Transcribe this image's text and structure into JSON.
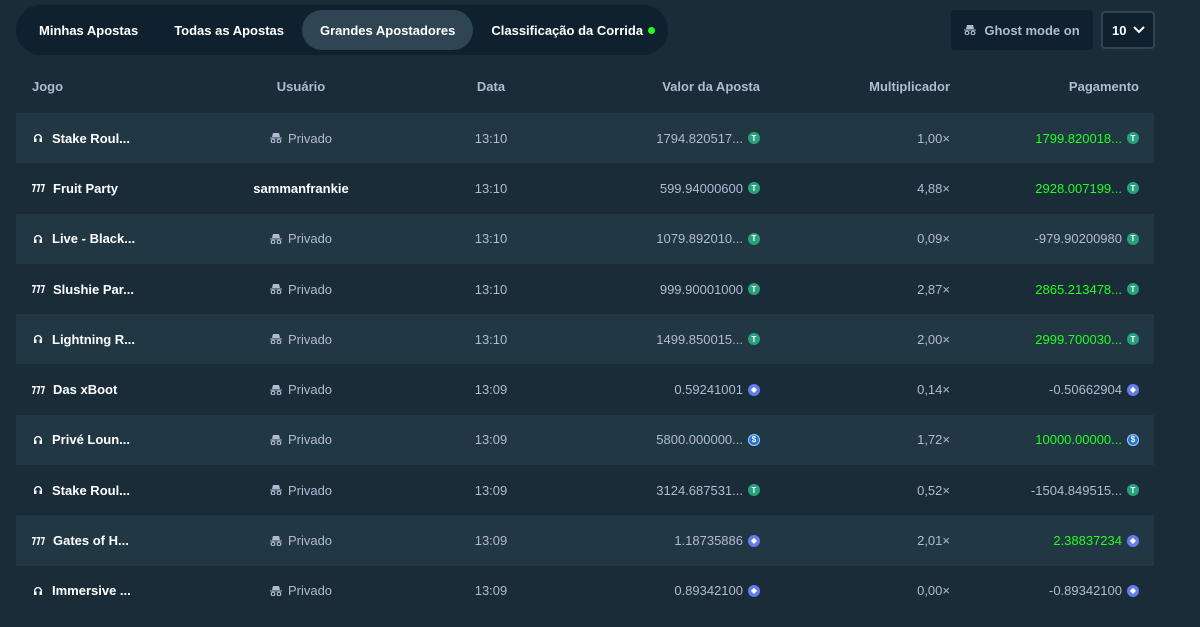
{
  "tabs": [
    {
      "label": "Minhas Apostas",
      "active": false
    },
    {
      "label": "Todas as Apostas",
      "active": false
    },
    {
      "label": "Grandes Apostadores",
      "active": true
    },
    {
      "label": "Classificação da Corrida",
      "active": false,
      "live": true
    }
  ],
  "ghost_mode": {
    "label": "Ghost mode on",
    "icon": "incognito-icon"
  },
  "rows_select": {
    "value": "10",
    "icon": "chevron-down-icon"
  },
  "colors": {
    "win": "#1fff20",
    "panel": "#0f212e",
    "bg": "#1a2c38",
    "row_alt": "#213743"
  },
  "table": {
    "headers": {
      "game": "Jogo",
      "user": "Usuário",
      "date": "Data",
      "bet": "Valor da Aposta",
      "mult": "Multiplicador",
      "payout": "Pagamento"
    },
    "rows": [
      {
        "game": "Stake Roul...",
        "game_icon": "live-casino-icon",
        "user": "Privado",
        "private": true,
        "date": "13:10",
        "bet": "1794.820517...",
        "mult": "1,00×",
        "payout": "1799.820018...",
        "win": true,
        "coin": "usdt"
      },
      {
        "game": "Fruit Party",
        "game_icon": "slots-icon",
        "user": "sammanfrankie",
        "private": false,
        "date": "13:10",
        "bet": "599.94000600",
        "mult": "4,88×",
        "payout": "2928.007199...",
        "win": true,
        "coin": "usdt"
      },
      {
        "game": "Live - Black...",
        "game_icon": "live-casino-icon",
        "user": "Privado",
        "private": true,
        "date": "13:10",
        "bet": "1079.892010...",
        "mult": "0,09×",
        "payout": "-979.90200980",
        "win": false,
        "coin": "usdt"
      },
      {
        "game": "Slushie Par...",
        "game_icon": "slots-icon",
        "user": "Privado",
        "private": true,
        "date": "13:10",
        "bet": "999.90001000",
        "mult": "2,87×",
        "payout": "2865.213478...",
        "win": true,
        "coin": "usdt"
      },
      {
        "game": "Lightning R...",
        "game_icon": "live-casino-icon",
        "user": "Privado",
        "private": true,
        "date": "13:10",
        "bet": "1499.850015...",
        "mult": "2,00×",
        "payout": "2999.700030...",
        "win": true,
        "coin": "usdt"
      },
      {
        "game": "Das xBoot",
        "game_icon": "slots-icon",
        "user": "Privado",
        "private": true,
        "date": "13:09",
        "bet": "0.59241001",
        "mult": "0,14×",
        "payout": "-0.50662904",
        "win": false,
        "coin": "eth"
      },
      {
        "game": "Privé Loun...",
        "game_icon": "live-casino-icon",
        "user": "Privado",
        "private": true,
        "date": "13:09",
        "bet": "5800.000000...",
        "mult": "1,72×",
        "payout": "10000.00000...",
        "win": true,
        "coin": "usdc"
      },
      {
        "game": "Stake Roul...",
        "game_icon": "live-casino-icon",
        "user": "Privado",
        "private": true,
        "date": "13:09",
        "bet": "3124.687531...",
        "mult": "0,52×",
        "payout": "-1504.849515...",
        "win": false,
        "coin": "usdt"
      },
      {
        "game": "Gates of H...",
        "game_icon": "slots-icon",
        "user": "Privado",
        "private": true,
        "date": "13:09",
        "bet": "1.18735886",
        "mult": "2,01×",
        "payout": "2.38837234",
        "win": true,
        "coin": "eth"
      },
      {
        "game": "Immersive ...",
        "game_icon": "live-casino-icon",
        "user": "Privado",
        "private": true,
        "date": "13:09",
        "bet": "0.89342100",
        "mult": "0,00×",
        "payout": "-0.89342100",
        "win": false,
        "coin": "eth"
      }
    ]
  }
}
